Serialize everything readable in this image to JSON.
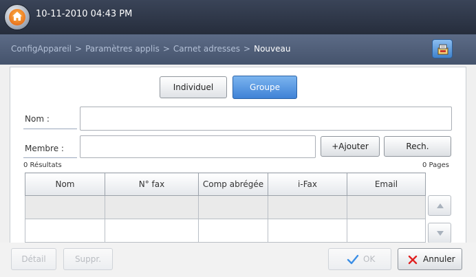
{
  "header": {
    "datetime": "10-11-2010 04:43 PM",
    "home_icon": "home-icon"
  },
  "breadcrumb": {
    "items": [
      "ConfigAppareil",
      "Paramètres applis",
      "Carnet adresses",
      "Nouveau"
    ],
    "separator": ">"
  },
  "mode_toggle": {
    "individual_label": "Individuel",
    "group_label": "Groupe",
    "selected": "Groupe"
  },
  "form": {
    "name_label": "Nom :",
    "name_value": "",
    "member_label": "Membre :",
    "member_value": "",
    "add_label": "+Ajouter",
    "search_label": "Rech."
  },
  "results": {
    "count_text": "0 Résultats",
    "pages_text": "0 Pages"
  },
  "table": {
    "columns": [
      "Nom",
      "N° fax",
      "Comp abrégée",
      "i-Fax",
      "Email"
    ],
    "rows": [
      [
        "",
        "",
        "",
        "",
        ""
      ],
      [
        "",
        "",
        "",
        "",
        ""
      ]
    ]
  },
  "footer": {
    "detail_label": "Détail",
    "delete_label": "Suppr.",
    "ok_label": "OK",
    "cancel_label": "Annuler"
  },
  "colors": {
    "accent_blue": "#3f82d6",
    "check_blue": "#3a8ee6",
    "cancel_red": "#e02020",
    "topbar": "#2b3242",
    "navbar": "#4f5d77"
  }
}
